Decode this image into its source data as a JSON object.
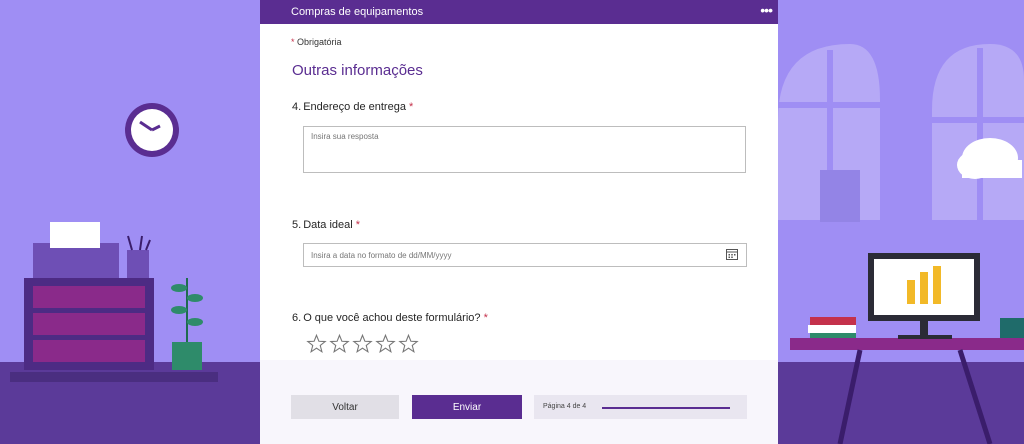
{
  "form": {
    "title": "Compras de equipamentos",
    "more_glyph": "•••",
    "required_star": "*",
    "required_note": "Obrigatória",
    "section_title": "Outras informações",
    "questions": [
      {
        "number": "4.",
        "label": "Endereço de entrega",
        "required": "*",
        "placeholder": "Insira sua resposta"
      },
      {
        "number": "5.",
        "label": "Data ideal",
        "required": "*",
        "placeholder": "Insira a data no formato de dd/MM/yyyy",
        "icon": "calendar-icon"
      },
      {
        "number": "6.",
        "label": "O que você achou deste formulário?",
        "required": "*",
        "rating_max": 5,
        "rating_value": 0,
        "icon": "star-icon"
      }
    ],
    "buttons": {
      "back": "Voltar",
      "submit": "Enviar"
    },
    "progress": {
      "label": "Página 4 de 4",
      "value": 1.0
    }
  },
  "colors": {
    "primary": "#5a2d91",
    "background": "#9f8ef4",
    "required": "#c4314b"
  }
}
